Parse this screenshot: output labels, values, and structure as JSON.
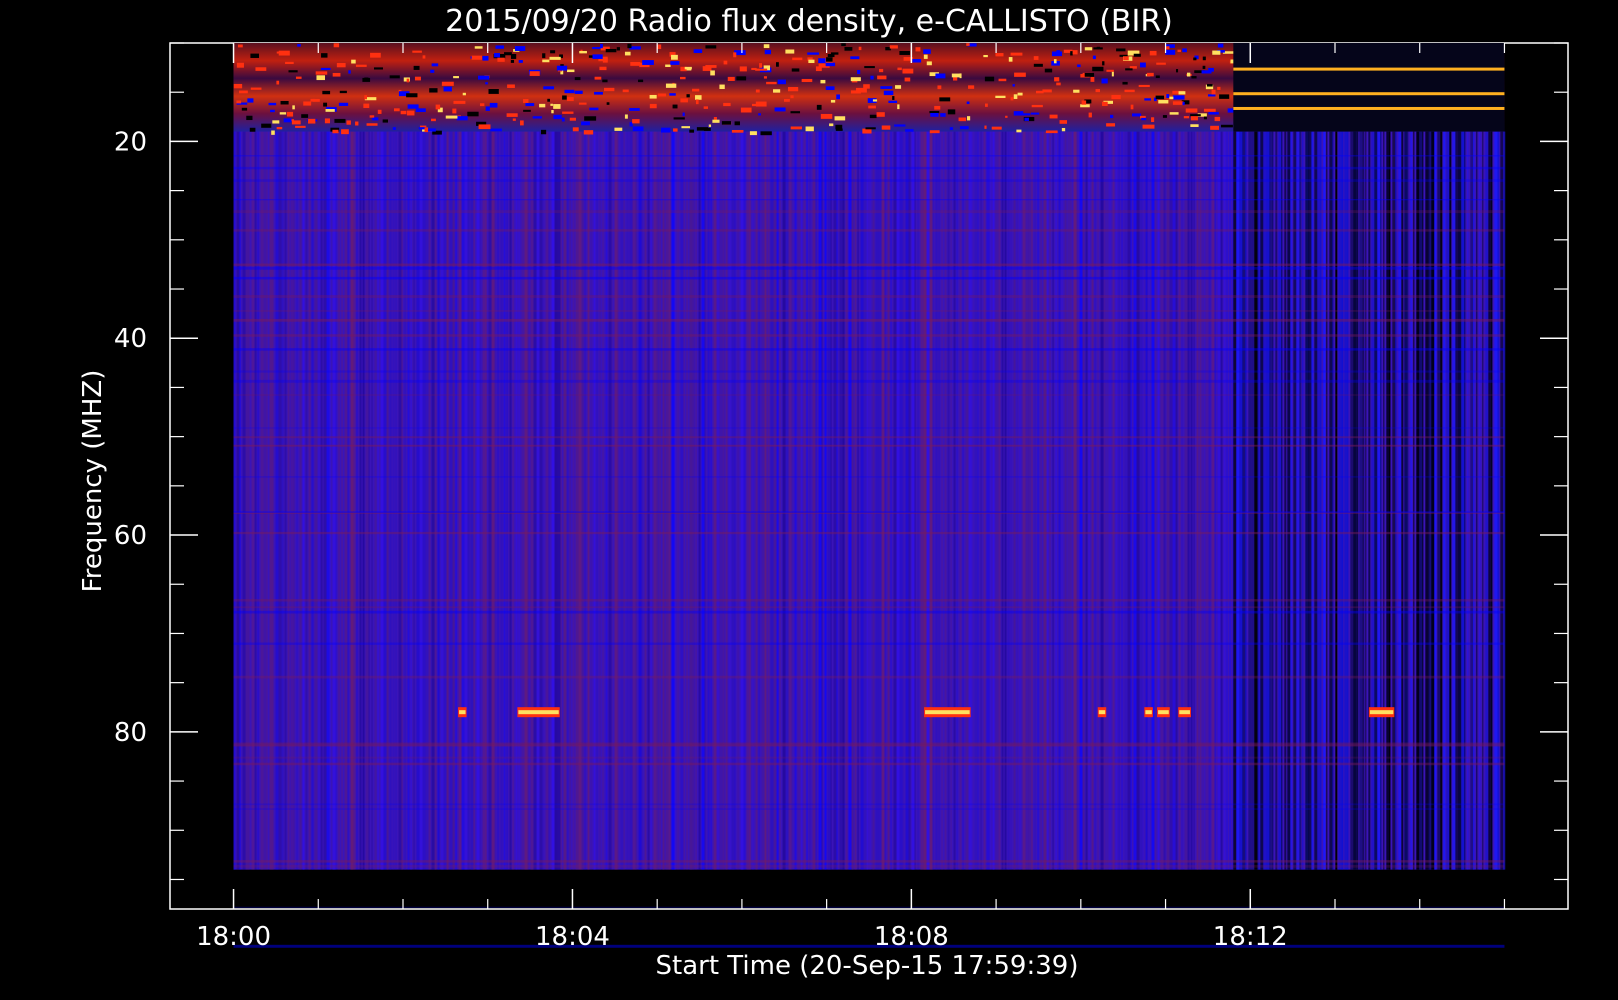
{
  "chart_data": {
    "type": "heatmap",
    "title": "2015/09/20  Radio flux density, e-CALLISTO (BIR)",
    "xlabel": "Start Time (20-Sep-15 17:59:39)",
    "ylabel": "Frequency (MHZ)",
    "x_ticks": [
      "18:00",
      "18:04",
      "18:08",
      "18:12"
    ],
    "x_tick_minutes": [
      0,
      4,
      8,
      12
    ],
    "x_range_minutes": [
      -0.75,
      15.75
    ],
    "data_range_minutes": [
      0.0,
      15.0
    ],
    "y_ticks": [
      20,
      40,
      60,
      80
    ],
    "y_range_mhz": [
      10,
      98
    ],
    "data_range_mhz": [
      10,
      94
    ],
    "y_inverted": true,
    "colormap": [
      "#000000",
      "#0000ff",
      "#8a1a4a",
      "#ff2000",
      "#ffff80"
    ],
    "features": {
      "rfi_top_band_mhz": [
        10,
        19
      ],
      "quiet_region_start_minute": 11.8,
      "bursts_near_78mhz_minutes": [
        [
          2.65,
          2.75
        ],
        [
          3.35,
          3.85
        ],
        [
          8.15,
          8.7
        ],
        [
          10.2,
          10.3
        ],
        [
          10.75,
          10.85
        ],
        [
          10.9,
          11.05
        ],
        [
          11.15,
          11.3
        ],
        [
          13.4,
          13.7
        ]
      ]
    }
  }
}
